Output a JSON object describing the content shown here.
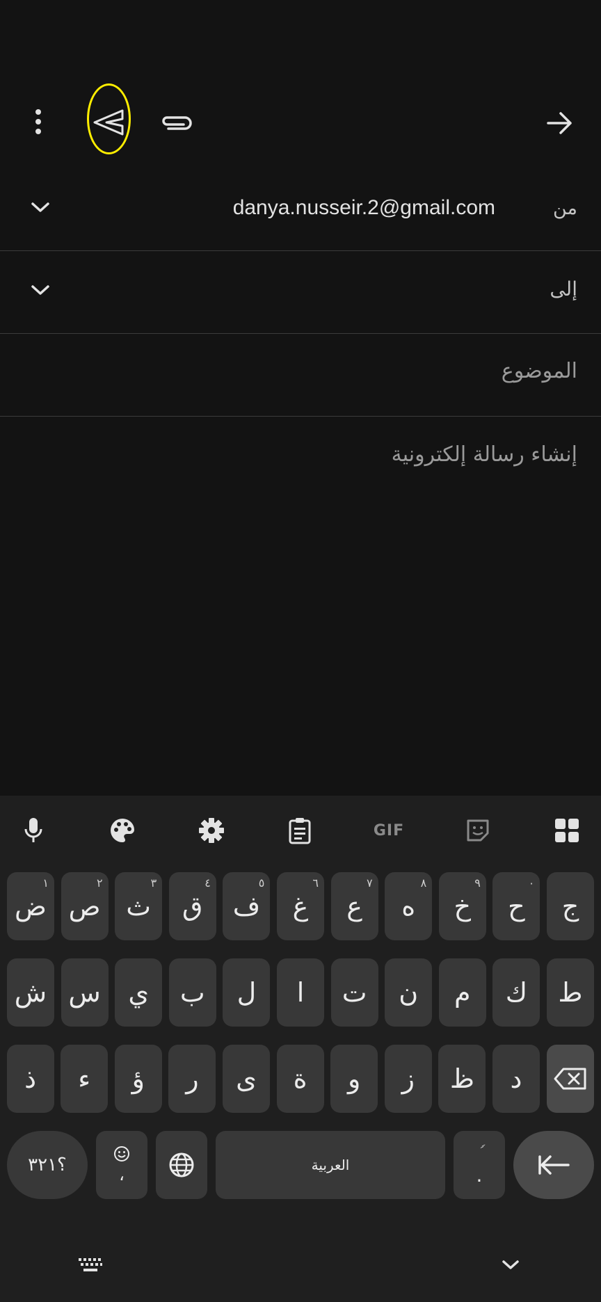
{
  "toolbar": {
    "more_icon": "more-vert-icon",
    "send_icon": "send-icon",
    "attach_icon": "paperclip-icon",
    "forward_icon": "arrow-forward-icon"
  },
  "compose": {
    "from_label": "من",
    "from_value": "danya.nusseir.2@gmail.com",
    "to_label": "إلى",
    "subject_placeholder": "الموضوع",
    "body_placeholder": "إنشاء رسالة إلكترونية"
  },
  "keyboard": {
    "toolbar_icons": [
      "mic-icon",
      "palette-icon",
      "settings-icon",
      "clipboard-icon",
      "gif-icon",
      "sticker-icon",
      "apps-grid-icon"
    ],
    "gif_label": "GIF",
    "row1": [
      {
        "char": "ج",
        "hint": ""
      },
      {
        "char": "ح",
        "hint": "٠"
      },
      {
        "char": "خ",
        "hint": "٩"
      },
      {
        "char": "ه",
        "hint": "٨"
      },
      {
        "char": "ع",
        "hint": "٧"
      },
      {
        "char": "غ",
        "hint": "٦"
      },
      {
        "char": "ف",
        "hint": "٥"
      },
      {
        "char": "ق",
        "hint": "٤"
      },
      {
        "char": "ث",
        "hint": "٣"
      },
      {
        "char": "ص",
        "hint": "٢"
      },
      {
        "char": "ض",
        "hint": "١"
      }
    ],
    "row2": [
      "ط",
      "ك",
      "م",
      "ن",
      "ت",
      "ا",
      "ل",
      "ب",
      "ي",
      "س",
      "ش"
    ],
    "row3": [
      "د",
      "ظ",
      "ز",
      "و",
      "ة",
      "ى",
      "ر",
      "ؤ",
      "ء",
      "ذ"
    ],
    "symbols_label": "؟٣٢١",
    "emoji_comma": "،",
    "space_label": "العربية",
    "period_label": ".",
    "period_hint": "ࣰ"
  },
  "navbar": {
    "keyboard_icon": "keyboard-icon",
    "hide_icon": "chevron-down-icon"
  }
}
